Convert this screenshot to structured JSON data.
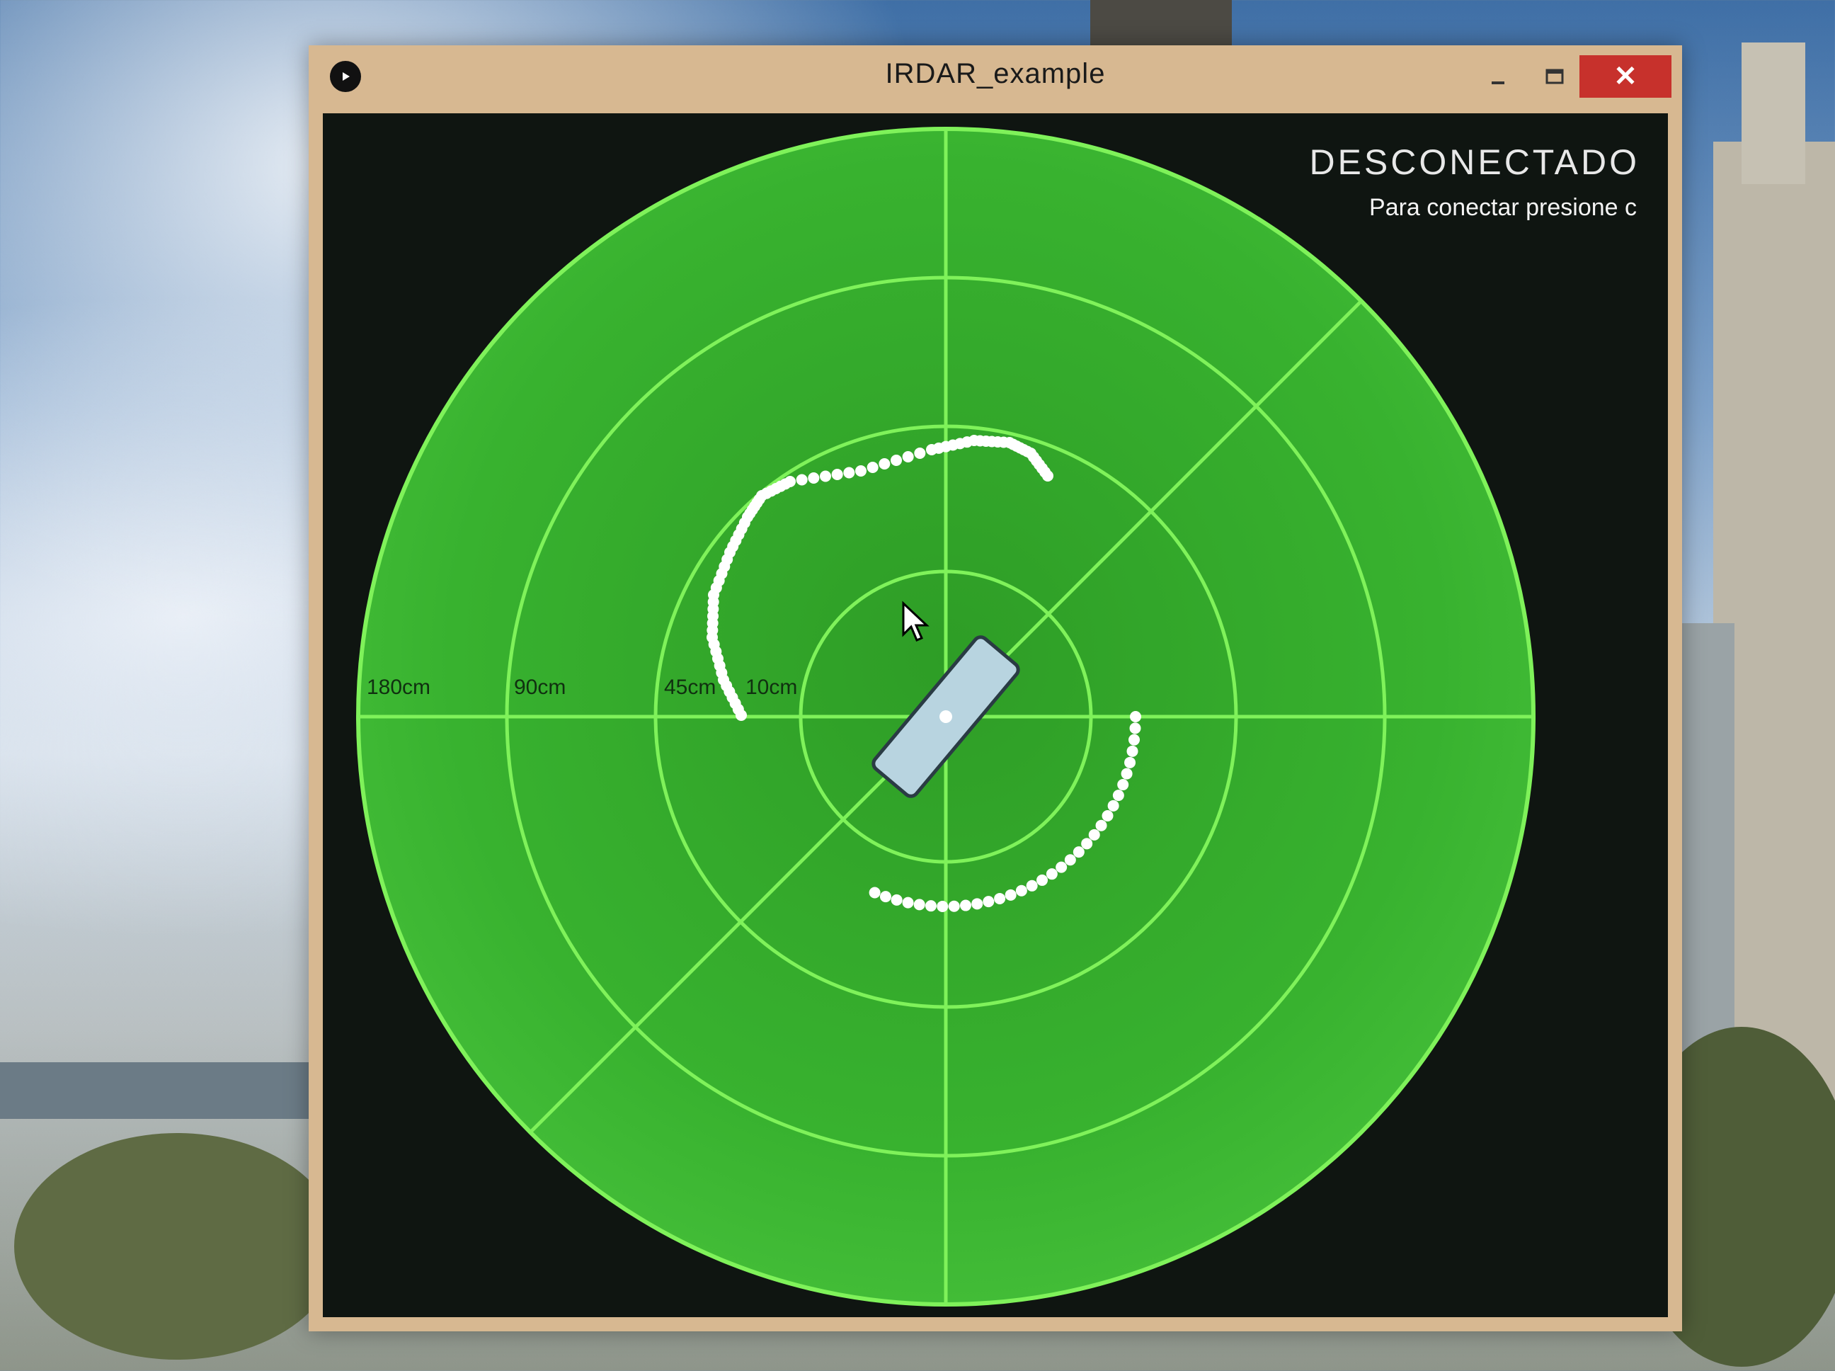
{
  "window": {
    "title": "IRDAR_example",
    "close_label": "✕"
  },
  "radar": {
    "status": "DESCONECTADO",
    "hint": "Para conectar presione c",
    "ring_labels": [
      "180cm",
      "90cm",
      "45cm",
      "10cm"
    ],
    "colors": {
      "fill": "#38b22f",
      "grid": "#7ff25a",
      "points": "#ffffff",
      "sensor": "#b8d4e0"
    }
  },
  "icons": [
    "processing-play-icon",
    "minimize-icon",
    "maximize-icon",
    "close-icon",
    "mouse-cursor-icon"
  ]
}
